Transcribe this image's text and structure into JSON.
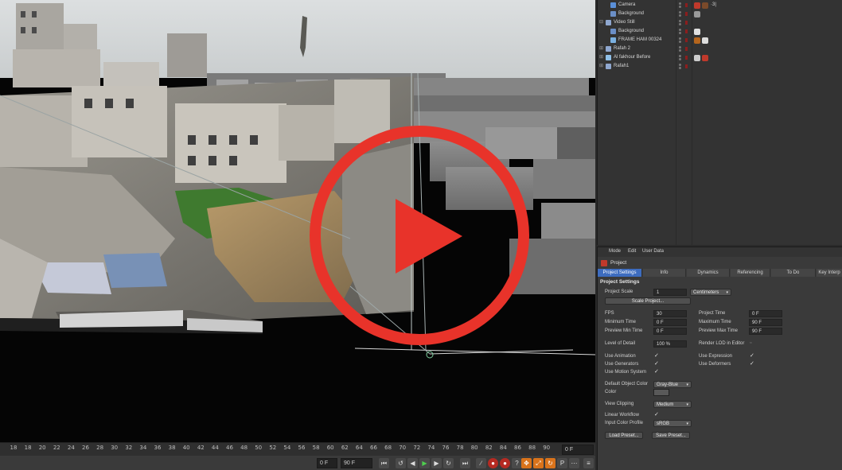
{
  "object_manager": {
    "objects": [
      {
        "name": "Camera",
        "expander": "",
        "icon": "camera-icon",
        "tags": [
          "#c0392b",
          "#7a4a2a"
        ],
        "extra": "·3|"
      },
      {
        "name": "Background",
        "expander": "",
        "icon": "background-icon",
        "tags": [
          "#9a9a9a"
        ],
        "extra": ""
      },
      {
        "name": "Video Still",
        "expander": "⊟",
        "icon": "null-layer-icon",
        "tags": [],
        "extra": ""
      },
      {
        "name": "Background",
        "expander": "",
        "icon": "background-icon",
        "tags": [
          "#e0e0e0"
        ],
        "extra": ""
      },
      {
        "name": "FRAME HAM 00324",
        "expander": "",
        "icon": "plane-icon",
        "tags": [
          "#b5651d",
          "#dddddd"
        ],
        "extra": ""
      },
      {
        "name": "Rafah 2",
        "expander": "⊞",
        "icon": "null-layer-icon",
        "tags": [],
        "extra": ""
      },
      {
        "name": "Al fakhour Before",
        "expander": "⊞",
        "icon": "mesh-icon",
        "tags": [
          "#cccccc",
          "#c0392b"
        ],
        "extra": ""
      },
      {
        "name": "Rafah1",
        "expander": "⊞",
        "icon": "null-layer-icon",
        "tags": [],
        "extra": ""
      }
    ]
  },
  "attributes": {
    "menu": [
      "Mode",
      "Edit",
      "User Data"
    ],
    "title": "Project",
    "tabs": [
      "Project Settings",
      "Info",
      "Dynamics",
      "Referencing",
      "To Do",
      "Key Interp"
    ],
    "section": "Project Settings",
    "project_scale": {
      "label": "Project Scale",
      "value": "1",
      "unit": "Centimeters"
    },
    "scale_button": "Scale Project...",
    "fps": {
      "label": "FPS",
      "value": "30"
    },
    "project_time": {
      "label": "Project Time",
      "value": "0 F"
    },
    "min_time": {
      "label": "Minimum Time",
      "value": "0 F"
    },
    "max_time": {
      "label": "Maximum Time",
      "value": "90 F"
    },
    "preview_min": {
      "label": "Preview Min Time",
      "value": "0 F"
    },
    "preview_max": {
      "label": "Preview Max Time",
      "value": "90 F"
    },
    "lod": {
      "label": "Level of Detail",
      "value": "100 %"
    },
    "render_lod": {
      "label": "Render LOD in Editor",
      "checked": false
    },
    "use_animation": {
      "label": "Use Animation",
      "checked": true
    },
    "use_expression": {
      "label": "Use Expression",
      "checked": true
    },
    "use_generators": {
      "label": "Use Generators",
      "checked": true
    },
    "use_deformers": {
      "label": "Use Deformers",
      "checked": true
    },
    "use_motion": {
      "label": "Use Motion System",
      "checked": true
    },
    "default_color": {
      "label": "Default Object Color",
      "value": "Gray-Blue"
    },
    "color": {
      "label": "Color"
    },
    "view_clipping": {
      "label": "View Clipping",
      "value": "Medium"
    },
    "linear_workflow": {
      "label": "Linear Workflow",
      "checked": true
    },
    "input_color_profile": {
      "label": "Input Color Profile",
      "value": "sRGB"
    },
    "load_preset": "Load Preset...",
    "save_preset": "Save Preset..."
  },
  "timeline": {
    "ticks": [
      "18",
      "18",
      "20",
      "22",
      "24",
      "26",
      "28",
      "30",
      "32",
      "34",
      "36",
      "38",
      "40",
      "42",
      "44",
      "46",
      "48",
      "50",
      "52",
      "54",
      "56",
      "58",
      "60",
      "62",
      "64",
      "66",
      "68",
      "70",
      "72",
      "74",
      "76",
      "78",
      "80",
      "82",
      "84",
      "86",
      "88",
      "90"
    ],
    "start_field": "0 F",
    "end_field": "90 F",
    "current_field": "0 F"
  },
  "overlay": {
    "play_icon": "play-icon",
    "ring_color": "#e8332a"
  }
}
